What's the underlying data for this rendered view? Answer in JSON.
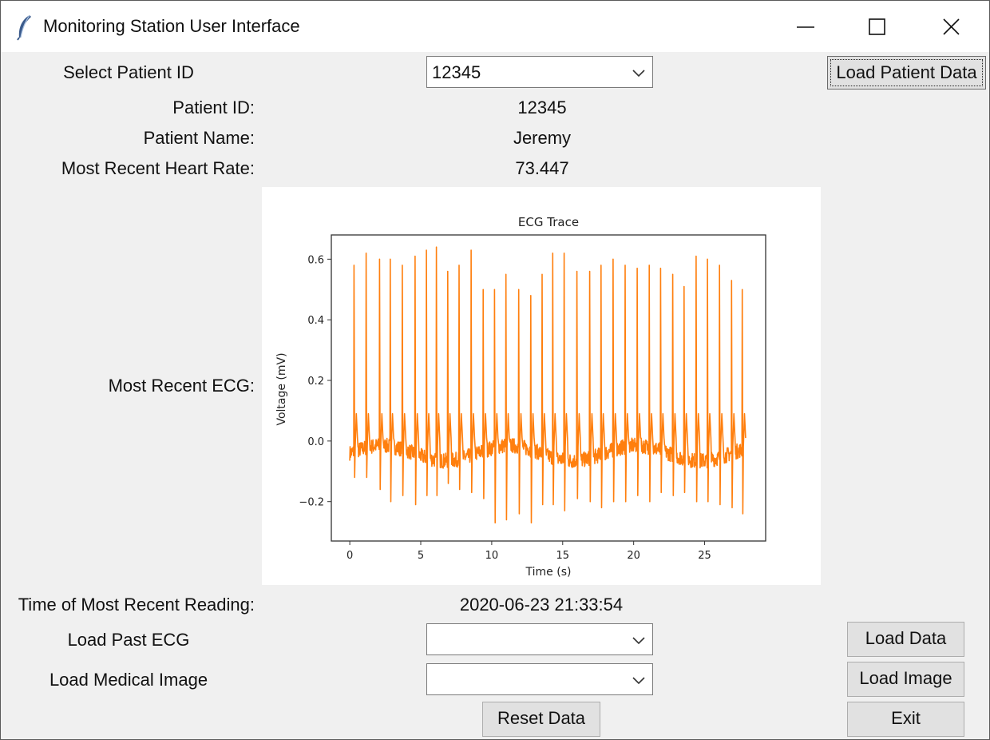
{
  "window": {
    "title": "Monitoring Station User Interface",
    "icon": "feather-icon",
    "controls": [
      "minimize-icon",
      "maximize-icon",
      "close-icon"
    ]
  },
  "select_patient": {
    "label": "Select Patient ID",
    "value": "12345",
    "button": "Load Patient Data"
  },
  "patient": {
    "id_label": "Patient ID:",
    "id_value": "12345",
    "name_label": "Patient Name:",
    "name_value": "Jeremy",
    "hr_label": "Most Recent Heart Rate:",
    "hr_value": "73.447",
    "ecg_label": "Most Recent ECG:",
    "time_label": "Time of Most Recent Reading:",
    "time_value": "2020-06-23 21:33:54"
  },
  "past_ecg": {
    "label": "Load Past ECG",
    "value": "",
    "button": "Load Data"
  },
  "medical_image": {
    "label": "Load Medical Image",
    "value": "",
    "button": "Load Image"
  },
  "actions": {
    "reset": "Reset Data",
    "exit": "Exit"
  },
  "colors": {
    "trace": "#ff7f0e",
    "window_bg": "#f0f0f0",
    "button_bg": "#e1e1e1"
  },
  "chart_data": {
    "type": "line",
    "title": "ECG Trace",
    "xlabel": "Time (s)",
    "ylabel": "Voltage (mV)",
    "xlim": [
      -1.3,
      29.3
    ],
    "ylim": [
      -0.33,
      0.68
    ],
    "xticks": [
      0,
      5,
      10,
      15,
      20,
      25
    ],
    "yticks": [
      -0.2,
      0.0,
      0.2,
      0.4,
      0.6
    ],
    "ytick_labels": [
      "−0.2",
      "0.0",
      "0.2",
      "0.4",
      "0.6"
    ],
    "grid": false,
    "baseline": 0.0,
    "beats": [
      {
        "t": 0.3,
        "peak": 0.58,
        "trough": -0.12
      },
      {
        "t": 1.15,
        "peak": 0.62,
        "trough": -0.12
      },
      {
        "t": 2.1,
        "peak": 0.6,
        "trough": -0.16
      },
      {
        "t": 2.85,
        "peak": 0.6,
        "trough": -0.2
      },
      {
        "t": 3.7,
        "peak": 0.58,
        "trough": -0.18
      },
      {
        "t": 4.6,
        "peak": 0.61,
        "trough": -0.21
      },
      {
        "t": 5.4,
        "peak": 0.63,
        "trough": -0.18
      },
      {
        "t": 6.1,
        "peak": 0.64,
        "trough": -0.18
      },
      {
        "t": 6.9,
        "peak": 0.56,
        "trough": -0.14
      },
      {
        "t": 7.7,
        "peak": 0.58,
        "trough": -0.16
      },
      {
        "t": 8.55,
        "peak": 0.63,
        "trough": -0.17
      },
      {
        "t": 9.4,
        "peak": 0.5,
        "trough": -0.19
      },
      {
        "t": 10.2,
        "peak": 0.5,
        "trough": -0.27
      },
      {
        "t": 11.0,
        "peak": 0.55,
        "trough": -0.26
      },
      {
        "t": 11.9,
        "peak": 0.5,
        "trough": -0.24
      },
      {
        "t": 12.75,
        "peak": 0.48,
        "trough": -0.27
      },
      {
        "t": 13.55,
        "peak": 0.55,
        "trough": -0.21
      },
      {
        "t": 14.3,
        "peak": 0.62,
        "trough": -0.21
      },
      {
        "t": 15.1,
        "peak": 0.62,
        "trough": -0.23
      },
      {
        "t": 16.0,
        "peak": 0.56,
        "trough": -0.19
      },
      {
        "t": 16.9,
        "peak": 0.56,
        "trough": -0.2
      },
      {
        "t": 17.7,
        "peak": 0.58,
        "trough": -0.22
      },
      {
        "t": 18.55,
        "peak": 0.6,
        "trough": -0.2
      },
      {
        "t": 19.4,
        "peak": 0.58,
        "trough": -0.2
      },
      {
        "t": 20.25,
        "peak": 0.57,
        "trough": -0.18
      },
      {
        "t": 21.1,
        "peak": 0.58,
        "trough": -0.2
      },
      {
        "t": 21.9,
        "peak": 0.57,
        "trough": -0.17
      },
      {
        "t": 22.75,
        "peak": 0.55,
        "trough": -0.18
      },
      {
        "t": 23.55,
        "peak": 0.51,
        "trough": -0.17
      },
      {
        "t": 24.4,
        "peak": 0.61,
        "trough": -0.2
      },
      {
        "t": 25.2,
        "peak": 0.6,
        "trough": -0.2
      },
      {
        "t": 26.05,
        "peak": 0.58,
        "trough": -0.21
      },
      {
        "t": 26.9,
        "peak": 0.53,
        "trough": -0.22
      },
      {
        "t": 27.65,
        "peak": 0.5,
        "trough": -0.24
      }
    ],
    "end_time": 27.8
  }
}
